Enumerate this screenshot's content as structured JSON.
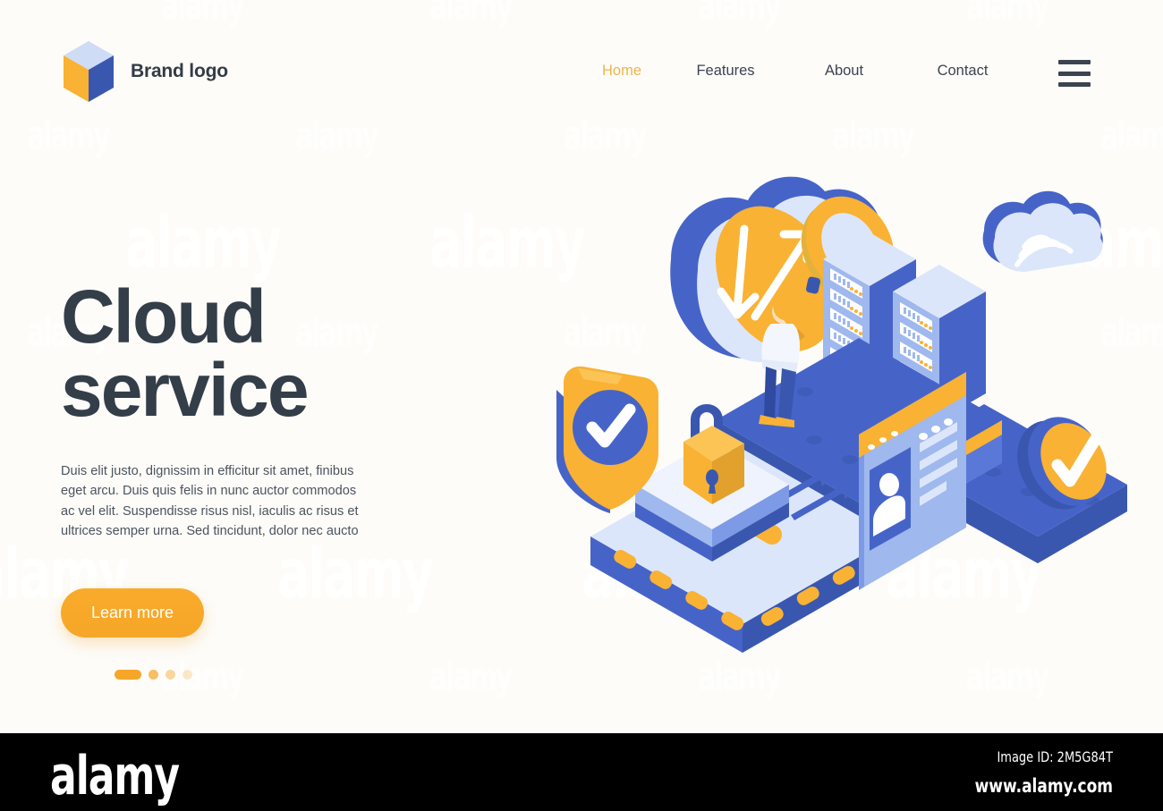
{
  "page": {
    "background_color": "#fdfcf9",
    "accent_color": "#f6a628",
    "brand_blue": "#4664c8",
    "text_dark": "#343e49"
  },
  "header": {
    "brand_name": "Brand logo",
    "logo_icon": "isometric-cube-logo",
    "nav": [
      {
        "label": "Home",
        "active": true
      },
      {
        "label": "Features",
        "active": false
      },
      {
        "label": "About",
        "active": false
      },
      {
        "label": "Contact",
        "active": false
      }
    ],
    "menu_icon": "hamburger-menu-icon"
  },
  "hero": {
    "title_line1": "Cloud",
    "title_line2": "service",
    "paragraph": "Duis elit justo, dignissim in efficitur sit amet, finibus eget arcu. Duis quis felis in nunc auctor commodos ac vel elit. Suspendisse risus nisl, iaculis ac risus et ultrices semper urna. Sed tincidunt, dolor nec aucto",
    "cta_label": "Learn more",
    "pagination": {
      "total": 4,
      "active_index": 0
    }
  },
  "illustration": {
    "name": "isometric-cloud-service-illustration",
    "elements": [
      "cloud-sync-arrows-icon",
      "magnifier-icon",
      "person-figure",
      "server-rack-tall",
      "server-rack-short",
      "wifi-cloud-icon",
      "shield-check-badge",
      "padlock-icon",
      "profile-card",
      "check-circle-badge",
      "upload-arrows",
      "platform-base"
    ]
  },
  "watermark": {
    "text": "alamy"
  },
  "footer": {
    "logo": "alamy",
    "image_id": "Image ID: 2M5G84T",
    "url": "www.alamy.com"
  }
}
